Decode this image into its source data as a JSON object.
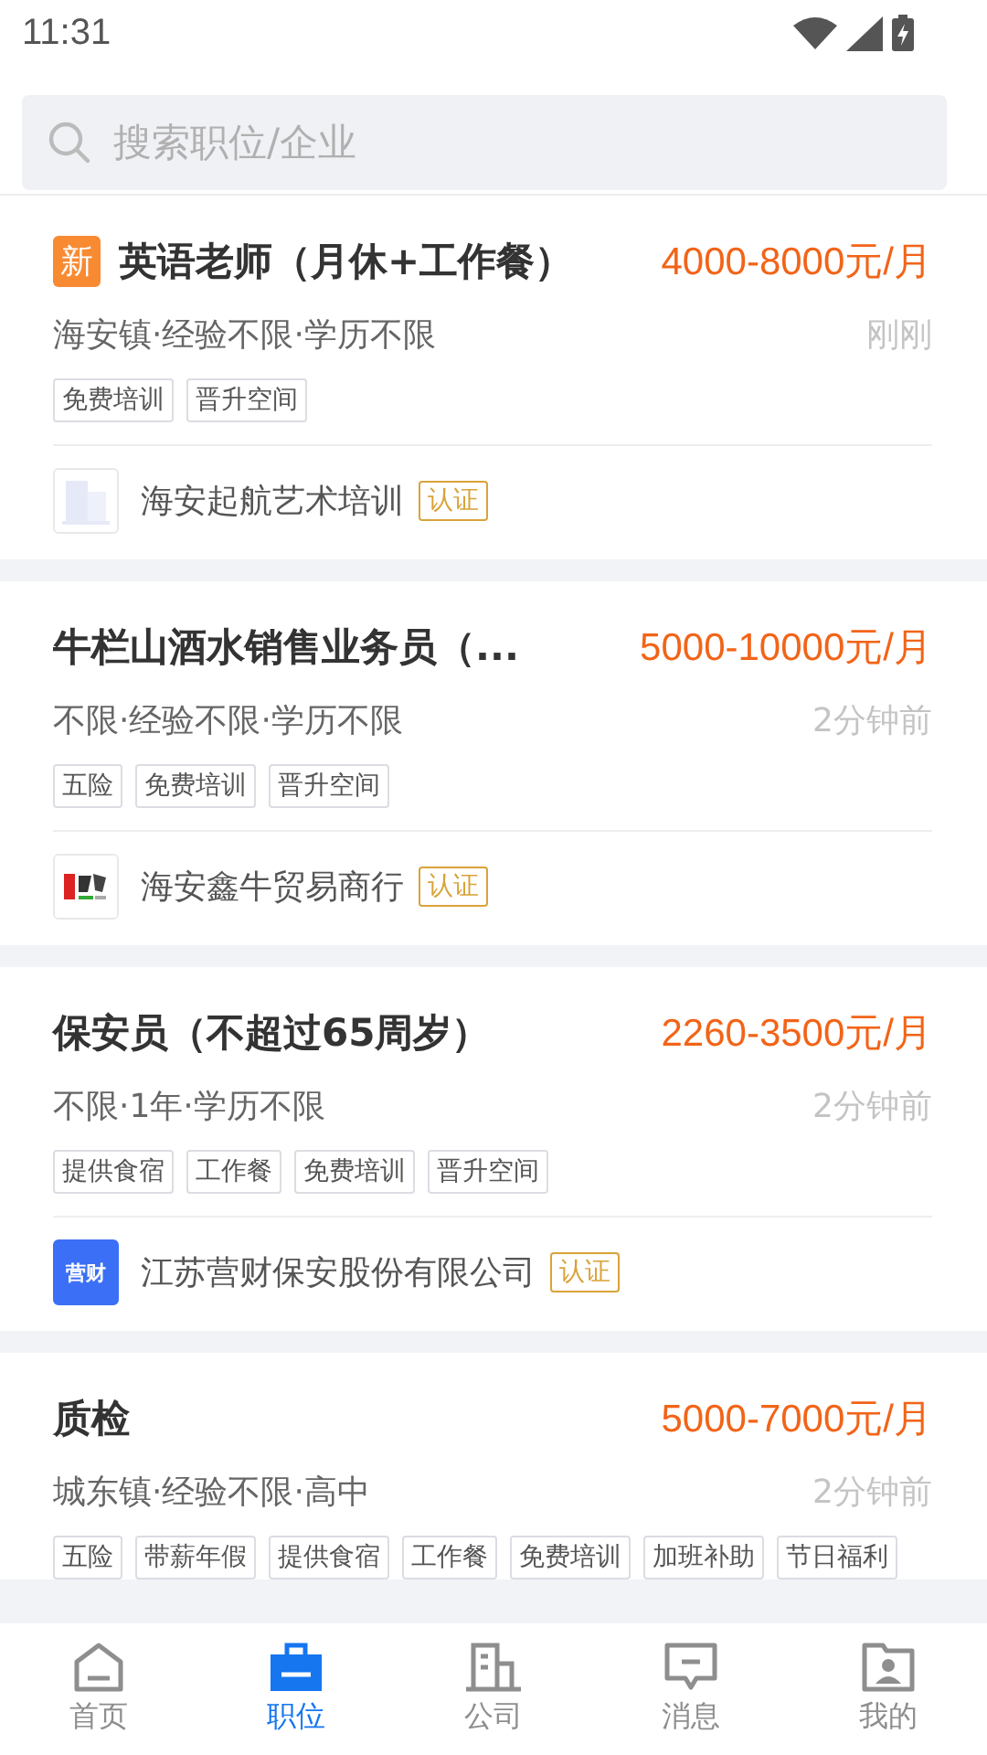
{
  "status_bar": {
    "time": "11:31"
  },
  "search": {
    "placeholder": "搜索职位/企业"
  },
  "jobs": [
    {
      "is_new": true,
      "new_badge": "新",
      "title": "英语老师（月休+工作餐）",
      "salary": "4000-8000元/月",
      "meta": "海安镇·经验不限·学历不限",
      "posted": "刚刚",
      "tags": [
        "免费培训",
        "晋升空间"
      ],
      "company": {
        "kind": "placeholder",
        "name": "海安起航艺术培训",
        "verified": true,
        "verified_label": "认证"
      }
    },
    {
      "is_new": false,
      "title": "牛栏山酒水销售业务员（...",
      "salary": "5000-10000元/月",
      "meta": "不限·经验不限·学历不限",
      "posted": "2分钟前",
      "tags": [
        "五险",
        "免费培训",
        "晋升空间"
      ],
      "company": {
        "name": "海安鑫牛贸易商行",
        "verified": true,
        "verified_label": "认证"
      }
    },
    {
      "is_new": false,
      "title": "保安员（不超过65周岁）",
      "salary": "2260-3500元/月",
      "meta": "不限·1年·学历不限",
      "posted": "2分钟前",
      "tags": [
        "提供食宿",
        "工作餐",
        "免费培训",
        "晋升空间"
      ],
      "company": {
        "kind": "text",
        "logo_text": "营财",
        "name": "江苏营财保安股份有限公司",
        "verified": true,
        "verified_label": "认证"
      }
    },
    {
      "is_new": false,
      "title": "质检",
      "salary": "5000-7000元/月",
      "meta": "城东镇·经验不限·高中",
      "posted": "2分钟前",
      "tags": [
        "五险",
        "带薪年假",
        "提供食宿",
        "工作餐",
        "免费培训",
        "加班补助",
        "节日福利"
      ]
    }
  ],
  "nav": [
    {
      "kind": "home",
      "label": "首页",
      "selected": false
    },
    {
      "kind": "jobs",
      "label": "职位",
      "selected": true
    },
    {
      "kind": "company",
      "label": "公司",
      "selected": false
    },
    {
      "kind": "messages",
      "label": "消息",
      "selected": false
    },
    {
      "kind": "profile",
      "label": "我的",
      "selected": false
    }
  ]
}
